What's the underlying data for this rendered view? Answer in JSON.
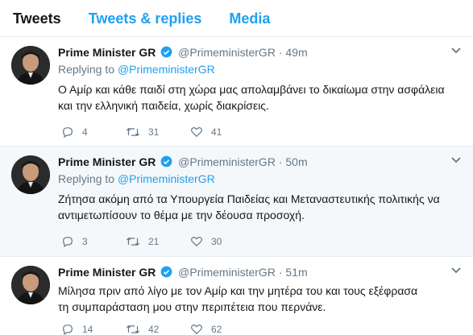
{
  "tabs": {
    "tweets": "Tweets",
    "tweets_replies": "Tweets & replies",
    "media": "Media"
  },
  "colors": {
    "accent": "#1da1f2",
    "muted": "#657786",
    "text": "#14171a",
    "highlight_bg": "#f5f8fa"
  },
  "tweets": [
    {
      "name": "Prime Minister GR",
      "handle": "@PrimeministerGR",
      "dot": "·",
      "time": "49m",
      "replying_prefix": "Replying to",
      "replying_handle": "@PrimeministerGR",
      "line1": "Ο Αμίρ και κάθε παιδί στη χώρα μας απολαμβάνει το δικαίωμα στην ασφάλεια",
      "line2": "και την ελληνική παιδεία, χωρίς διακρίσεις.",
      "replies": "4",
      "retweets": "31",
      "likes": "41"
    },
    {
      "name": "Prime Minister GR",
      "handle": "@PrimeministerGR",
      "dot": "·",
      "time": "50m",
      "replying_prefix": "Replying to",
      "replying_handle": "@PrimeministerGR",
      "line1": "Ζήτησα ακόμη από τα Υπουργεία Παιδείας και Μεταναστευτικής πολιτικής να",
      "line2": "αντιμετωπίσουν το θέμα με την δέουσα προσοχή.",
      "replies": "3",
      "retweets": "21",
      "likes": "30"
    },
    {
      "name": "Prime Minister GR",
      "handle": "@PrimeministerGR",
      "dot": "·",
      "time": "51m",
      "line1": "Μίλησα πριν από λίγο με τον Αμίρ και την μητέρα του και τους εξέφρασα",
      "line2": "τη συμπαράσταση μου στην περιπέτεια που περνάνε.",
      "replies": "14",
      "retweets": "42",
      "likes": "62"
    }
  ]
}
